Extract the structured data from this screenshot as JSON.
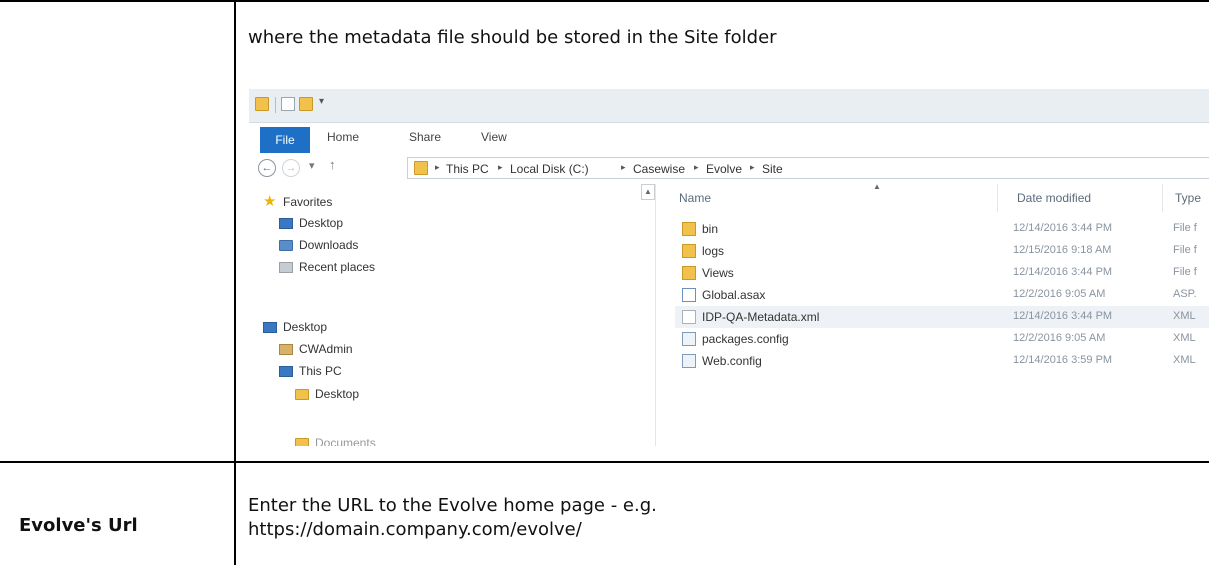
{
  "rows": [
    {
      "label": "",
      "description": "where the metadata file should be stored in the Site folder"
    },
    {
      "label": "Evolve's Url",
      "description_lines": [
        "Enter the URL to the Evolve home page - e.g.",
        "https://domain.company.com/evolve/"
      ]
    }
  ],
  "explorer": {
    "ribbon_tabs": [
      "File",
      "Home",
      "Share",
      "View"
    ],
    "quick_access_dropdown": "▾",
    "nav_buttons": {
      "back": "←",
      "forward": "→",
      "recent": "▾",
      "up": "↑"
    },
    "breadcrumb": [
      "This PC",
      "Local Disk (C:)",
      "Casewise",
      "Evolve",
      "Site"
    ],
    "breadcrumb_separator": "▸",
    "sidebar": {
      "favorites_label": "Favorites",
      "favorites": [
        "Desktop",
        "Downloads",
        "Recent places"
      ],
      "tree": [
        "Desktop",
        "CWAdmin",
        "This PC",
        "Desktop",
        "Documents"
      ]
    },
    "columns": {
      "name": "Name",
      "date": "Date modified",
      "type": "Type"
    },
    "files": [
      {
        "name": "bin",
        "date": "12/14/2016 3:44 PM",
        "type": "File f",
        "icon": "folder-icon"
      },
      {
        "name": "logs",
        "date": "12/15/2016 9:18 AM",
        "type": "File f",
        "icon": "folder-icon"
      },
      {
        "name": "Views",
        "date": "12/14/2016 3:44 PM",
        "type": "File f",
        "icon": "folder-icon"
      },
      {
        "name": "Global.asax",
        "date": "12/2/2016 9:05 AM",
        "type": "ASP.",
        "icon": "asax-file-icon"
      },
      {
        "name": "IDP-QA-Metadata.xml",
        "date": "12/14/2016 3:44 PM",
        "type": "XML",
        "icon": "xml-file-icon",
        "highlighted": true
      },
      {
        "name": "packages.config",
        "date": "12/2/2016 9:05 AM",
        "type": "XML",
        "icon": "config-file-icon"
      },
      {
        "name": "Web.config",
        "date": "12/14/2016 3:59 PM",
        "type": "XML",
        "icon": "config-file-icon"
      }
    ],
    "colors": {
      "file_tab": "#1e6fc6",
      "folder": "#f1c14b",
      "titlebar": "#e9eef3"
    }
  }
}
